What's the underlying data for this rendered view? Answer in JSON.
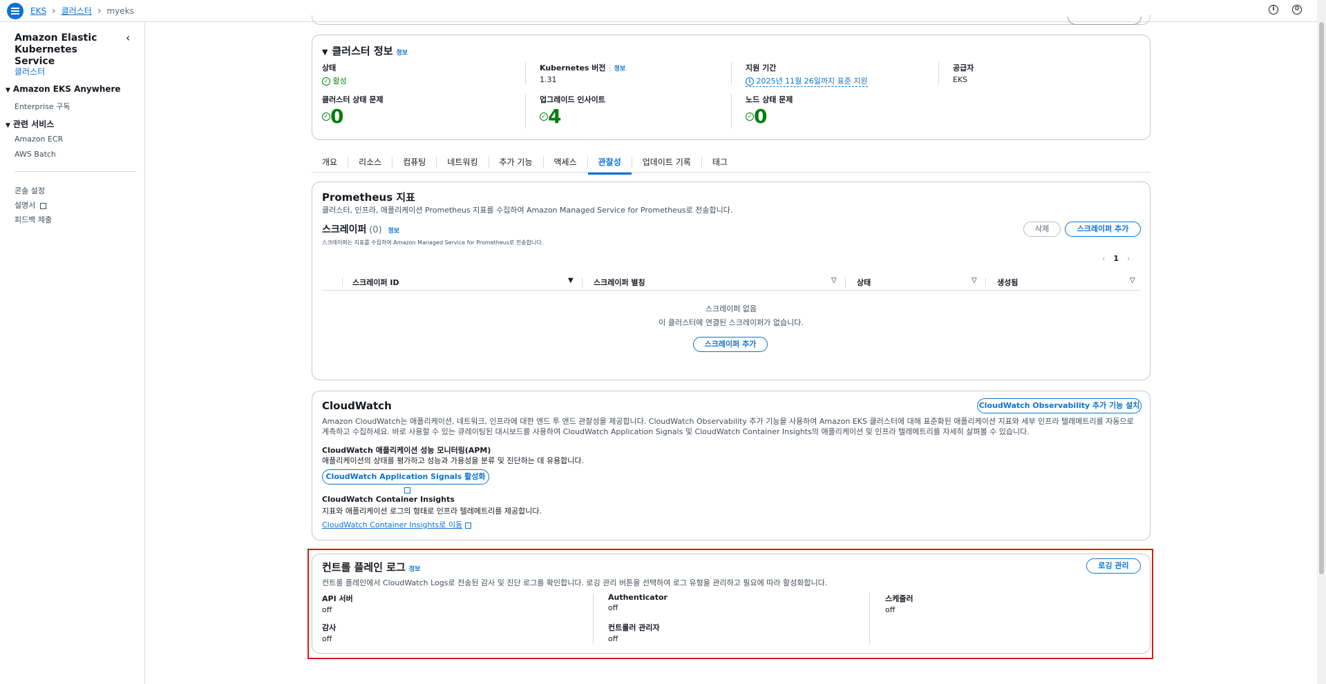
{
  "breadcrumb": {
    "items": [
      "EKS",
      "클러스터"
    ],
    "current": "myeks"
  },
  "sidebar": {
    "title": "Amazon Elastic Kubernetes Service",
    "active_item": "클러스터",
    "sections": [
      {
        "title": "Amazon EKS Anywhere",
        "items": [
          "Enterprise 구독"
        ]
      },
      {
        "title": "관련 서비스",
        "items": [
          "Amazon ECR",
          "AWS Batch"
        ]
      }
    ],
    "footer_items": [
      "콘솔 설정",
      "설명서",
      "피드백 제출"
    ]
  },
  "cluster_info": {
    "title": "클러스터 정보",
    "info_label": "정보",
    "status_label": "상태",
    "status_value": "활성",
    "k8s_version_label": "Kubernetes 버전",
    "k8s_version_value": "1.31",
    "support_label": "지원 기간",
    "support_value": "2025년 11월 26일까지 표준 지원",
    "provider_label": "공급자",
    "provider_value": "EKS",
    "health_label": "클러스터 상태 문제",
    "health_value": "0",
    "upgrade_label": "업그레이드 인사이트",
    "upgrade_value": "4",
    "node_label": "노드 상태 문제",
    "node_value": "0"
  },
  "tabs": [
    "개요",
    "리소스",
    "컴퓨팅",
    "네트워킹",
    "추가 기능",
    "액세스",
    "관찰성",
    "업데이트 기록",
    "태그"
  ],
  "active_tab": "관찰성",
  "prometheus": {
    "title": "Prometheus 지표",
    "description": "클러스터, 인프라, 애플리케이션 Prometheus 지표를 수집하여 Amazon Managed Service for Prometheus로 전송합니다.",
    "scrapers_title": "스크레이퍼",
    "scrapers_count": "(0)",
    "info_label": "정보",
    "scrapers_desc": "스크레이퍼는 지표를 수집하여 Amazon Managed Service for Prometheus로 전송합니다.",
    "delete_label": "삭제",
    "add_label": "스크레이퍼 추가",
    "page": "1",
    "columns": [
      "스크레이퍼 ID",
      "스크레이퍼 별칭",
      "상태",
      "생성됨"
    ],
    "empty_title": "스크레이퍼 없음",
    "empty_desc": "이 클러스터에 연결된 스크레이퍼가 없습니다.",
    "empty_add_label": "스크레이퍼 추가"
  },
  "cloudwatch": {
    "title": "CloudWatch",
    "install_label": "CloudWatch Observability 추가 기능 설치",
    "description": "Amazon CloudWatch는 애플리케이션, 네트워크, 인프라에 대한 엔드 투 엔드 관찰성을 제공합니다. CloudWatch Observability 추가 기능을 사용하여 Amazon EKS 클러스터에 대해 표준화된 애플리케이션 지표와 세부 인프라 텔레메트리를 자동으로 계측하고 수집하세요. 바로 사용할 수 있는 큐레이팅된 대시보드를 사용하여 CloudWatch Application Signals 및 CloudWatch Container Insights의 애플리케이션 및 인프라 텔레메트리를 자세히 살펴볼 수 있습니다.",
    "apm_title": "CloudWatch 애플리케이션 성능 모니터링(APM)",
    "apm_desc": "애플리케이션의 상태를 평가하고 성능과 가용성을 분류 및 진단하는 데 유용합니다.",
    "apm_button": "CloudWatch Application Signals 활성화",
    "ci_title": "CloudWatch Container Insights",
    "ci_desc": "지표와 애플리케이션 로그의 형태로 인프라 텔레메트리를 제공합니다.",
    "ci_link": "CloudWatch Container Insights로 이동"
  },
  "control_plane": {
    "title": "컨트롤 플레인 로그",
    "info_label": "정보",
    "manage_label": "로깅 관리",
    "description": "컨트롤 플레인에서 CloudWatch Logs로 전송된 감사 및 진단 로그를 확인합니다. 로깅 관리 버튼을 선택하여 로그 유형을 관리하고 필요에 따라 활성화합니다.",
    "logs": [
      {
        "label": "API 서버",
        "value": "off"
      },
      {
        "label": "Authenticator",
        "value": "off"
      },
      {
        "label": "스케줄러",
        "value": "off"
      },
      {
        "label": "감사",
        "value": "off"
      },
      {
        "label": "컨트롤러 관리자",
        "value": "off"
      }
    ]
  }
}
